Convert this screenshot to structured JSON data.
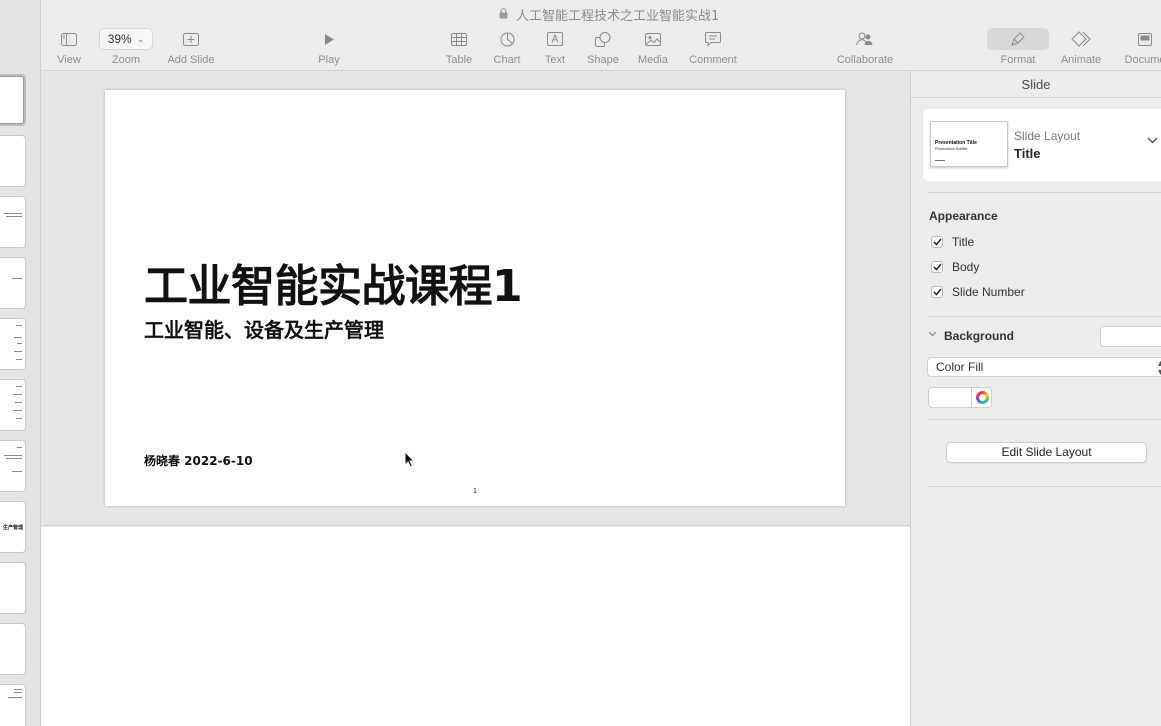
{
  "window": {
    "title": "人工智能工程技术之工业智能实战1"
  },
  "toolbar": {
    "view": "View",
    "zoom_value": "39%",
    "zoom": "Zoom",
    "add_slide": "Add Slide",
    "play": "Play",
    "table": "Table",
    "chart": "Chart",
    "text": "Text",
    "shape": "Shape",
    "media": "Media",
    "comment": "Comment",
    "collaborate": "Collaborate",
    "format": "Format",
    "animate": "Animate",
    "document": "Docume"
  },
  "navigator": {
    "thumb_8_title": "生产管理"
  },
  "slide": {
    "title": "工业智能实战课程1",
    "subtitle": "工业智能、设备及生产管理",
    "author_date": "杨晓春 2022-6-10",
    "number": "1"
  },
  "inspector": {
    "header": "Slide",
    "layout_caption": "Slide Layout",
    "layout_name": "Title",
    "layout_thumb_title": "Presentation Title",
    "layout_thumb_subtitle": "Presentation Subtitle",
    "appearance": "Appearance",
    "appearance_items": [
      "Title",
      "Body",
      "Slide Number"
    ],
    "background": "Background",
    "fill_type": "Color Fill",
    "edit_layout": "Edit Slide Layout"
  },
  "colors": {
    "toolbar_bg": "#ececec",
    "canvas_bg": "#e6e6e6",
    "inspector_bg": "#ececec",
    "label_gray": "#8d8d8d"
  }
}
